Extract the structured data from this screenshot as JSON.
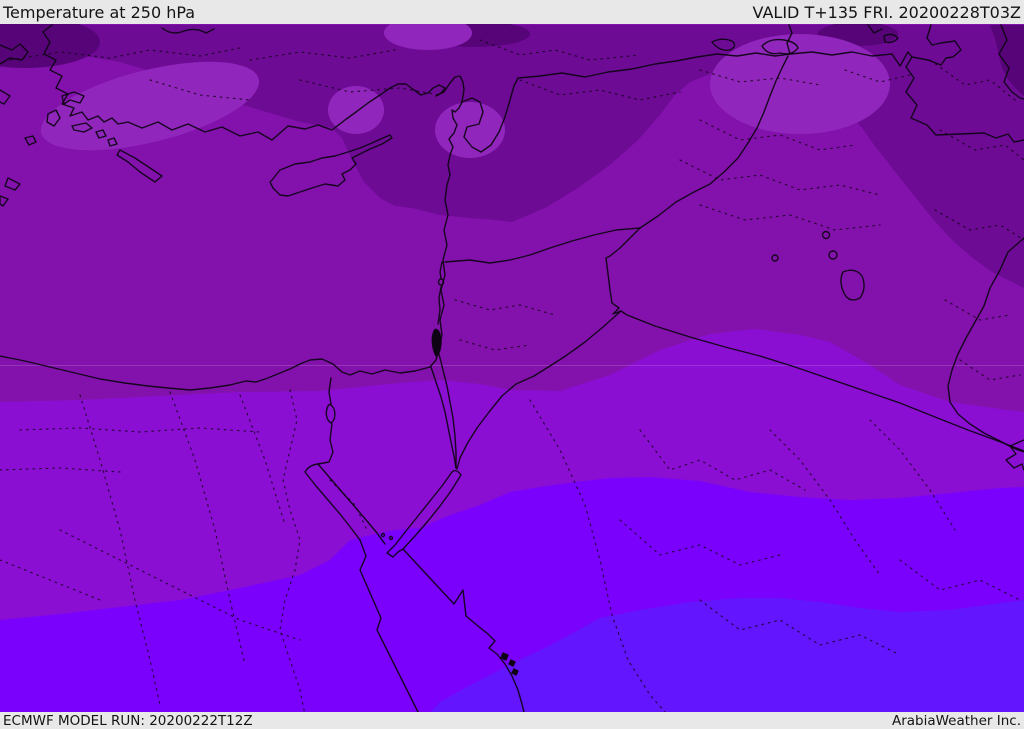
{
  "header": {
    "title": "Temperature at 250 hPa",
    "valid": "VALID T+135 FRI. 20200228T03Z"
  },
  "footer": {
    "model_run": "ECMWF MODEL RUN: 20200222T12Z",
    "credit": "ArabiaWeather Inc."
  },
  "map": {
    "colors": {
      "band_dark": "#6d0b95",
      "band_darkest": "#570479",
      "band_base": "#8312ac",
      "band_patch": "#9126bc",
      "band_bright": "#8b0fd3",
      "band_violet": "#7a02fc",
      "band_blue_violet": "#6315fd",
      "border_line": "#0d0312",
      "bar_background": "#e8e8e8",
      "bar_text": "#141414"
    }
  }
}
